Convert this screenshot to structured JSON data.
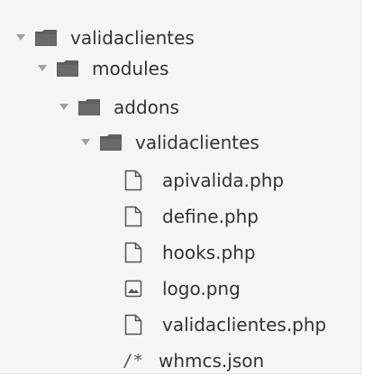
{
  "tree": {
    "folders": [
      {
        "label": "validaclientes",
        "icon": "folder-icon",
        "expanded": true
      },
      {
        "label": "modules",
        "icon": "folder-icon",
        "expanded": true
      },
      {
        "label": "addons",
        "icon": "folder-icon",
        "expanded": true
      },
      {
        "label": "validaclientes",
        "icon": "folder-icon",
        "expanded": true
      }
    ],
    "files": [
      {
        "label": "apivalida.php",
        "icon": "file-icon"
      },
      {
        "label": "define.php",
        "icon": "file-icon"
      },
      {
        "label": "hooks.php",
        "icon": "file-icon"
      },
      {
        "label": "logo.png",
        "icon": "image-file-icon"
      },
      {
        "label": "validaclientes.php",
        "icon": "file-icon"
      },
      {
        "label": "whmcs.json",
        "icon": "json-file-icon",
        "glyph": "/*"
      }
    ]
  },
  "colors": {
    "panel_background": "#f5f5f5",
    "text": "#333333",
    "folder_fill": "#606060",
    "arrow": "#a0a0a0"
  }
}
